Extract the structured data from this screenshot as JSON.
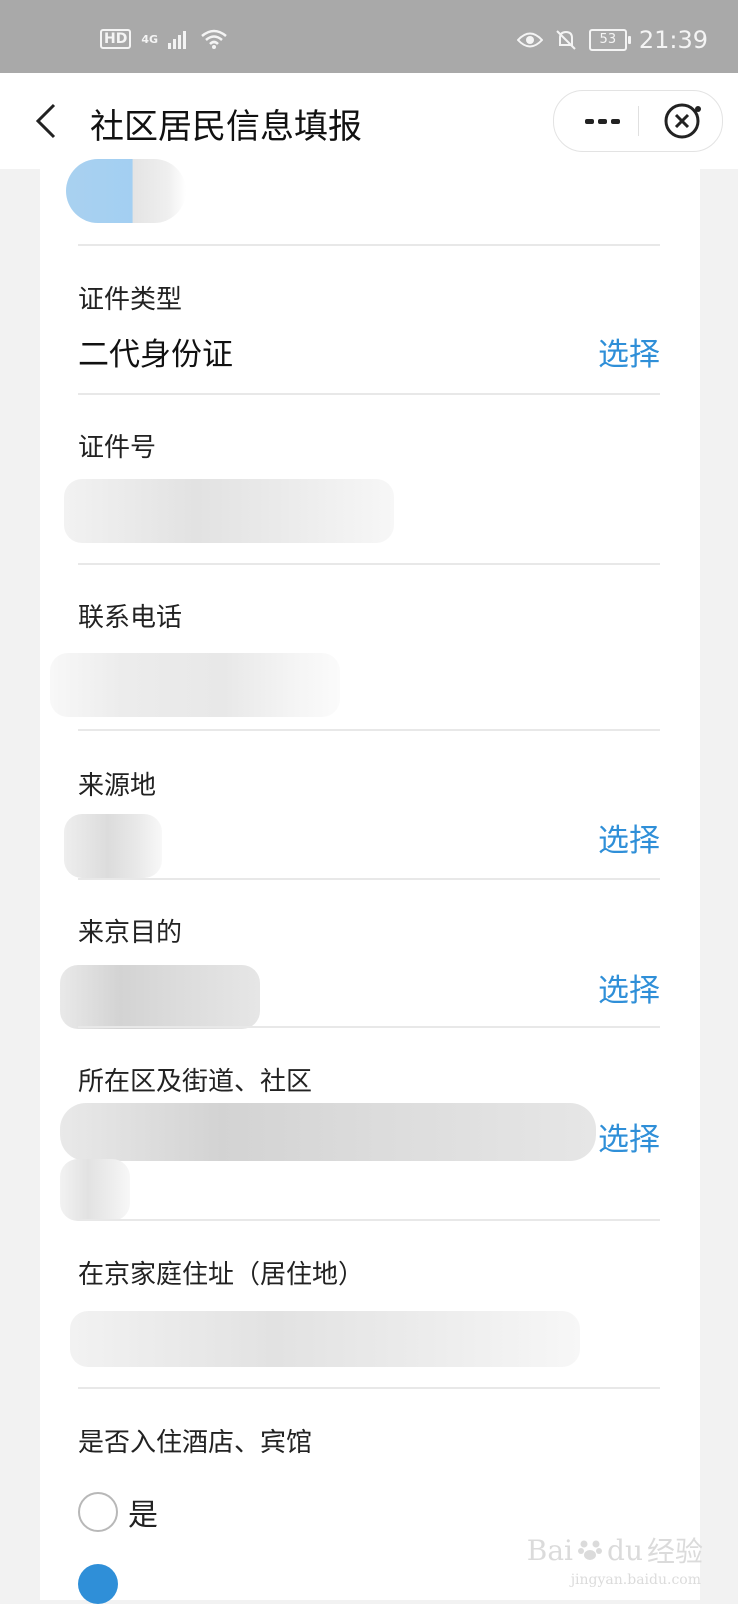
{
  "status_bar": {
    "hd_badge": "HD",
    "network": "4G",
    "battery": "53",
    "time": "21:39"
  },
  "header": {
    "title": "社区居民信息填报"
  },
  "form": {
    "id_type": {
      "label": "证件类型",
      "value": "二代身份证",
      "action": "选择"
    },
    "id_number": {
      "label": "证件号"
    },
    "phone": {
      "label": "联系电话"
    },
    "origin": {
      "label": "来源地",
      "action": "选择"
    },
    "purpose": {
      "label": "来京目的",
      "action": "选择"
    },
    "district": {
      "label": "所在区及街道、社区",
      "action": "选择"
    },
    "address": {
      "label": "在京家庭住址（居住地）"
    },
    "hotel": {
      "label": "是否入住酒店、宾馆",
      "option_yes": "是"
    }
  },
  "watermark": {
    "brand": "Bai",
    "brand_tail": "du",
    "cn": "经验",
    "url": "jingyan.baidu.com"
  },
  "colors": {
    "accent": "#2f8fd8",
    "status_bar": "#a9a9a9",
    "background": "#f2f2f2"
  }
}
